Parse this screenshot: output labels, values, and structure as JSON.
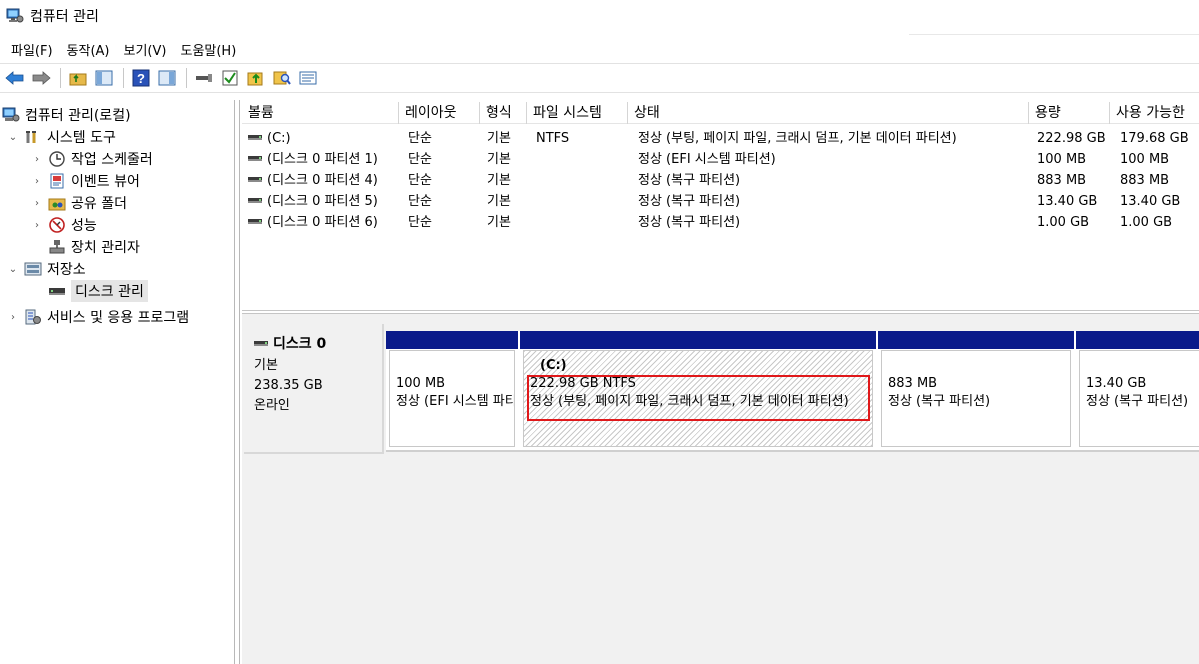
{
  "window": {
    "title": "컴퓨터 관리"
  },
  "menu": [
    "파일(F)",
    "동작(A)",
    "보기(V)",
    "도움말(H)"
  ],
  "tree": {
    "root": "컴퓨터 관리(로컬)",
    "system_tools": "시스템 도구",
    "task_scheduler": "작업 스케줄러",
    "event_viewer": "이벤트 뷰어",
    "shared_folders": "공유 폴더",
    "performance": "성능",
    "device_manager": "장치 관리자",
    "storage": "저장소",
    "disk_management": "디스크 관리",
    "services_apps": "서비스 및 응용 프로그램"
  },
  "volume_table": {
    "headers": [
      "볼륨",
      "레이아웃",
      "형식",
      "파일 시스템",
      "상태",
      "용량",
      "사용 가능한"
    ],
    "rows": [
      [
        "(C:)",
        "단순",
        "기본",
        "NTFS",
        "정상 (부팅, 페이지 파일, 크래시 덤프, 기본 데이터 파티션)",
        "222.98 GB",
        "179.68 GB"
      ],
      [
        "(디스크 0 파티션 1)",
        "단순",
        "기본",
        "",
        "정상 (EFI 시스템 파티션)",
        "100 MB",
        "100 MB"
      ],
      [
        "(디스크 0 파티션 4)",
        "단순",
        "기본",
        "",
        "정상 (복구 파티션)",
        "883 MB",
        "883 MB"
      ],
      [
        "(디스크 0 파티션 5)",
        "단순",
        "기본",
        "",
        "정상 (복구 파티션)",
        "13.40 GB",
        "13.40 GB"
      ],
      [
        "(디스크 0 파티션 6)",
        "단순",
        "기본",
        "",
        "정상 (복구 파티션)",
        "1.00 GB",
        "1.00 GB"
      ]
    ]
  },
  "disk": {
    "name": "디스크 0",
    "type": "기본",
    "size": "238.35 GB",
    "status": "온라인"
  },
  "partitions": [
    {
      "name": "",
      "size": "100 MB",
      "status": "정상 (EFI 시스템 파티션)"
    },
    {
      "name": "(C:)",
      "size": "222.98 GB NTFS",
      "status": "정상 (부팅, 페이지 파일, 크래시 덤프, 기본 데이터 파티션)"
    },
    {
      "name": "",
      "size": "883 MB",
      "status": "정상 (복구 파티션)"
    },
    {
      "name": "",
      "size": "13.40 GB",
      "status": "정상 (복구 파티션)"
    }
  ],
  "colors": {
    "partition_header": "#0a1a8a",
    "selection_outline": "#e0181a"
  },
  "icons": [
    "computer-management-icon",
    "back-arrow-icon",
    "forward-arrow-icon",
    "up-folder-icon",
    "show-hide-console-tree-icon",
    "help-icon",
    "show-hide-action-pane-icon",
    "connect-icon",
    "check-icon",
    "up-arrow-icon",
    "search-icon",
    "properties-icon"
  ]
}
